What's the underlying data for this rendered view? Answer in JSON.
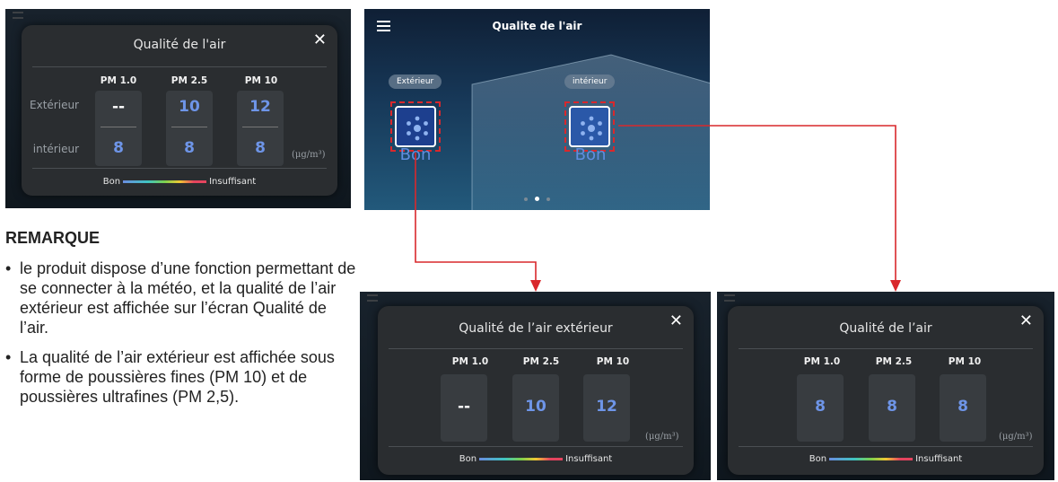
{
  "colors": {
    "accent_blue": "#6e95e8",
    "arrow_red": "#d9282c",
    "popup_bg": "#2a2d30"
  },
  "icons": {
    "close": "close-icon",
    "menu": "hamburger-menu-icon",
    "sensor": "air-sensor-icon"
  },
  "popup_combined": {
    "title": "Qualité de l'air",
    "close": "✕",
    "columns": [
      "PM 1.0",
      "PM 2.5",
      "PM 10"
    ],
    "rows": [
      {
        "label": "Extérieur",
        "values": [
          "--",
          "10",
          "12"
        ]
      },
      {
        "label": "intérieur",
        "values": [
          "8",
          "8",
          "8"
        ]
      }
    ],
    "unit": "(μg/m³)",
    "legend": {
      "low": "Bon",
      "high": "Insuffisant"
    }
  },
  "main_screen": {
    "title": "Qualite de l'air",
    "outdoor": {
      "label": "Extérieur",
      "status": "Bon"
    },
    "indoor": {
      "label": "intérieur",
      "status": "Bon"
    },
    "pages": 3,
    "active_page": 2
  },
  "remarque": {
    "heading": "REMARQUE",
    "items": [
      "le produit dispose d’une fonction permettant de se connecter à la météo, et la qualité de l’air extérieur est affichée sur l’écran Qualité de l’air.",
      "La qualité de l’air extérieur est affichée sous forme de poussières fines (PM 10) et de poussières ultrafines (PM 2,5)."
    ]
  },
  "popup_outdoor": {
    "title": "Qualité de l’air extérieur",
    "close": "✕",
    "columns": [
      "PM 1.0",
      "PM 2.5",
      "PM 10"
    ],
    "values": [
      "--",
      "10",
      "12"
    ],
    "unit": "(μg/m³)",
    "legend": {
      "low": "Bon",
      "high": "Insuffisant"
    }
  },
  "popup_indoor": {
    "title": "Qualité de l’air",
    "close": "✕",
    "columns": [
      "PM 1.0",
      "PM 2.5",
      "PM 10"
    ],
    "values": [
      "8",
      "8",
      "8"
    ],
    "unit": "(μg/m³)",
    "legend": {
      "low": "Bon",
      "high": "Insuffisant"
    }
  }
}
